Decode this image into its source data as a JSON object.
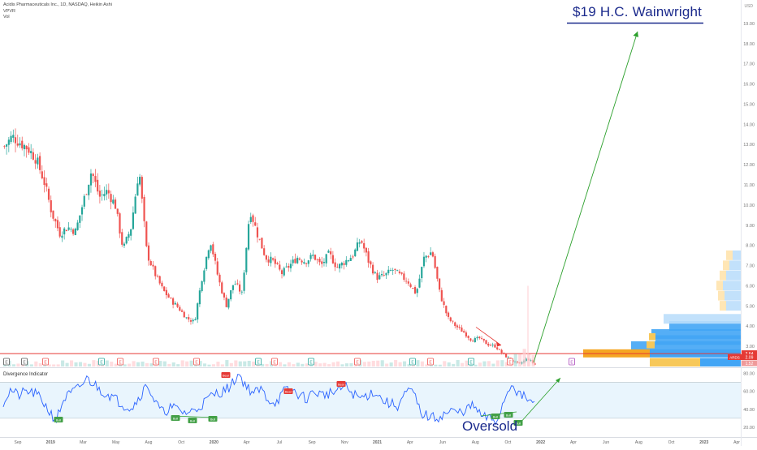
{
  "legend": {
    "symbol_line": "Acidis Pharmaceuticals Inc., 1D, NASDAQ, Heikin Ashi",
    "vpvr": "VPVR",
    "vol": "Vol"
  },
  "annotations": {
    "target_text": "$19 H.C. Wainwright",
    "oversold_text": "Oversold"
  },
  "currency": "USD",
  "colors": {
    "up": "#26a69a",
    "down": "#ef5350",
    "arrow": "#2ca02c",
    "support": "#e53935",
    "vp_blue": "#42a5f5",
    "vp_orange": "#f5a623",
    "text_blue": "#1b2a8c",
    "indicator_line": "#2962ff"
  },
  "price_badges": {
    "close": "2.64",
    "ticker": "ARDS",
    "last": "2.09",
    "low": "1.52"
  },
  "indicator_title": "Divergence Indicator",
  "event_markers": [
    "E",
    "E",
    "E",
    "E",
    "E",
    "E",
    "E",
    "E",
    "E",
    "E",
    "E",
    "E",
    "E",
    "E",
    "E",
    "E"
  ],
  "pivot_labels": [
    "Bull",
    "Bull",
    "Bull",
    "Bull",
    "Bull",
    "Bear",
    "Bear",
    "Bear",
    "Bull",
    "Bull"
  ],
  "chart_data": [
    {
      "type": "candlestick",
      "style": "Heikin Ashi",
      "x_ticks": [
        "Sep",
        "2019",
        "Mar",
        "May",
        "Aug",
        "Oct",
        "2020",
        "Apr",
        "Jul",
        "Sep",
        "Nov",
        "2021",
        "Apr",
        "Jun",
        "Aug",
        "Oct",
        "2022",
        "Apr",
        "Jun",
        "Aug",
        "Oct",
        "2023",
        "Apr"
      ],
      "y_ticks": [
        "19.00",
        "18.00",
        "17.00",
        "16.00",
        "15.00",
        "14.00",
        "13.00",
        "12.00",
        "11.00",
        "10.00",
        "9.00",
        "8.00",
        "7.00",
        "6.00",
        "5.00",
        "4.00",
        "3.00"
      ],
      "ylim": [
        2.0,
        20.0
      ],
      "close_series_approx": [
        12.9,
        13.4,
        13.1,
        12.8,
        12.3,
        11.2,
        9.6,
        8.6,
        8.9,
        8.7,
        10.2,
        11.7,
        10.4,
        10.7,
        10.0,
        7.8,
        8.9,
        11.8,
        7.6,
        6.6,
        5.8,
        5.3,
        4.9,
        4.4,
        4.2,
        6.5,
        8.3,
        6.4,
        5.0,
        6.2,
        5.6,
        9.8,
        8.5,
        7.4,
        7.2,
        6.6,
        7.0,
        7.4,
        7.2,
        7.5,
        7.0,
        7.6,
        6.9,
        7.2,
        7.5,
        8.3,
        7.2,
        6.4,
        6.5,
        6.8,
        6.5,
        6.2,
        5.6,
        7.4,
        7.7,
        5.6,
        4.4,
        4.0,
        3.7,
        3.3,
        3.4,
        3.1,
        3.0,
        2.6,
        2.3,
        2.1,
        2.4,
        2.09
      ],
      "annotations": [
        "$19 H.C. Wainwright",
        "Oversold"
      ],
      "support_level": 2.64
    },
    {
      "type": "line",
      "title": "Divergence Indicator",
      "y_ticks": [
        "80.00",
        "60.00",
        "40.00",
        "20.00"
      ],
      "ylim": [
        10,
        85
      ],
      "band": [
        30,
        70
      ],
      "values_approx": [
        48,
        62,
        55,
        60,
        58,
        52,
        38,
        28,
        52,
        58,
        64,
        74,
        68,
        60,
        56,
        50,
        44,
        42,
        55,
        68,
        48,
        36,
        42,
        40,
        36,
        38,
        44,
        52,
        58,
        60,
        66,
        80,
        66,
        58,
        62,
        50,
        48,
        60,
        62,
        56,
        52,
        60,
        56,
        58,
        60,
        66,
        58,
        52,
        56,
        60,
        50,
        46,
        44,
        58,
        60,
        36,
        32,
        30,
        34,
        38,
        36,
        40,
        44,
        32,
        30,
        26,
        50,
        70,
        56,
        52,
        45
      ]
    }
  ]
}
